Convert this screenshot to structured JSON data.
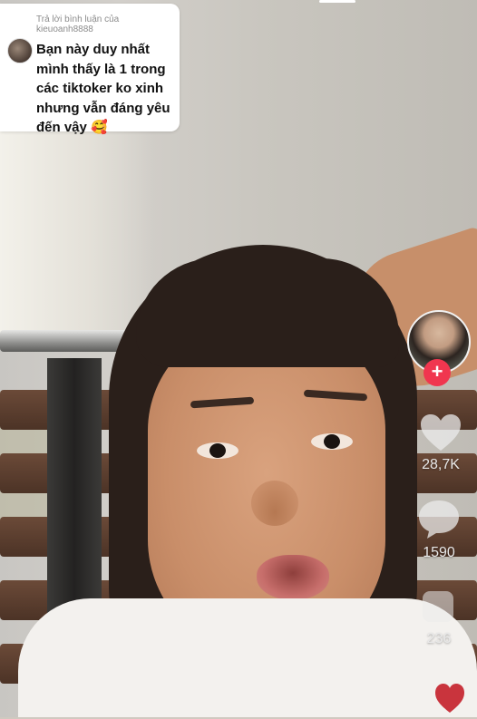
{
  "comment_card": {
    "reply_caption": "Trả lời bình luận của kieuoanh8888",
    "text": "Bạn này duy nhất mình thấy là 1 trong các tiktoker ko xinh nhưng vẫn đáng yêu đến vậy",
    "emoji": "🥰"
  },
  "actions": {
    "follow_symbol": "+",
    "likes": "28,7K",
    "comments": "1590",
    "saves": "236"
  },
  "icons": {
    "avatar": "commenter-avatar-icon",
    "creator": "creator-avatar",
    "like": "heart-icon",
    "comment": "comment-bubble-icon",
    "save": "sticker-icon",
    "share": "share-arrow-icon"
  },
  "colors": {
    "follow_accent": "#f0364f",
    "card_bg": "#ffffff"
  }
}
